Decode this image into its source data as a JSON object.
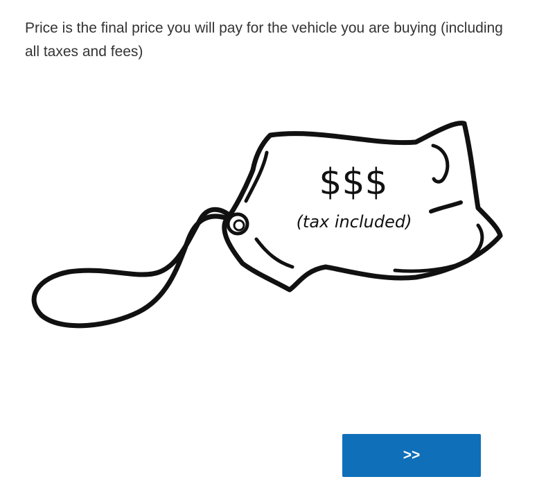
{
  "question": {
    "text": "Price is the final price you will pay for the vehicle you are buying (including all taxes and fees)"
  },
  "illustration": {
    "symbol": "$$$",
    "caption": "(tax included)"
  },
  "navigation": {
    "next_label": ">>",
    "button_color": "#0f6fb9"
  }
}
